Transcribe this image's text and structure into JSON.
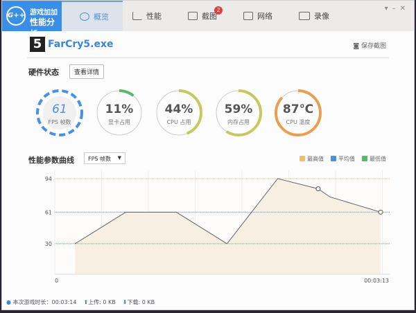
{
  "logo": {
    "icon": "G++",
    "line1": "游戏加加",
    "line2": "性能分析"
  },
  "tabs": [
    {
      "label": "概览",
      "icon": "eye-icon",
      "active": true
    },
    {
      "label": "性能",
      "icon": "bar-chart-icon"
    },
    {
      "label": "截图",
      "icon": "image-icon",
      "badge": "2"
    },
    {
      "label": "网络",
      "icon": "pulse-icon"
    },
    {
      "label": "录像",
      "icon": "video-icon"
    }
  ],
  "window_controls": {
    "menu": "▾",
    "minimize": "–",
    "close": "✕"
  },
  "app": {
    "icon_text": "5",
    "name": "FarCry5.exe"
  },
  "save_screenshot": "保存截图",
  "hardware": {
    "title": "硬件状态",
    "details_button": "查看详情",
    "gauges": [
      {
        "value": "61",
        "label": "FPS 帧数"
      },
      {
        "value": "11%",
        "label": "显卡占用",
        "fraction": 0.11
      },
      {
        "value": "44%",
        "label": "CPU 占用",
        "fraction": 0.44
      },
      {
        "value": "59%",
        "label": "内存占用",
        "fraction": 0.59
      },
      {
        "value": "87℃",
        "label": "CPU 温度",
        "fraction": 0.87
      }
    ]
  },
  "curve": {
    "title": "性能参数曲线",
    "select": "FPS 帧数",
    "legend": [
      {
        "label": "最高值",
        "color": "#e8c070"
      },
      {
        "label": "平均值",
        "color": "#4a90e2"
      },
      {
        "label": "最低值",
        "color": "#5cb870"
      }
    ]
  },
  "chart_data": {
    "type": "area",
    "x_unit": "seconds",
    "x": [
      12,
      42,
      72,
      102,
      132,
      156,
      163,
      193
    ],
    "y": [
      30,
      61,
      61,
      30,
      94,
      84,
      76,
      61
    ],
    "y_ticks": [
      30,
      61,
      94
    ],
    "x_tick_labels": [
      "0",
      "00:03:13"
    ],
    "xlim": [
      0,
      193
    ],
    "ylim": [
      0,
      100
    ],
    "max": 94,
    "avg": 61,
    "min": 30,
    "marked_points": [
      5,
      7
    ]
  },
  "status": {
    "duration_label": "本次游戏时长：",
    "duration": "00:03:14",
    "upload": "上传: 0 KB",
    "download": "下载: 0 KB"
  }
}
